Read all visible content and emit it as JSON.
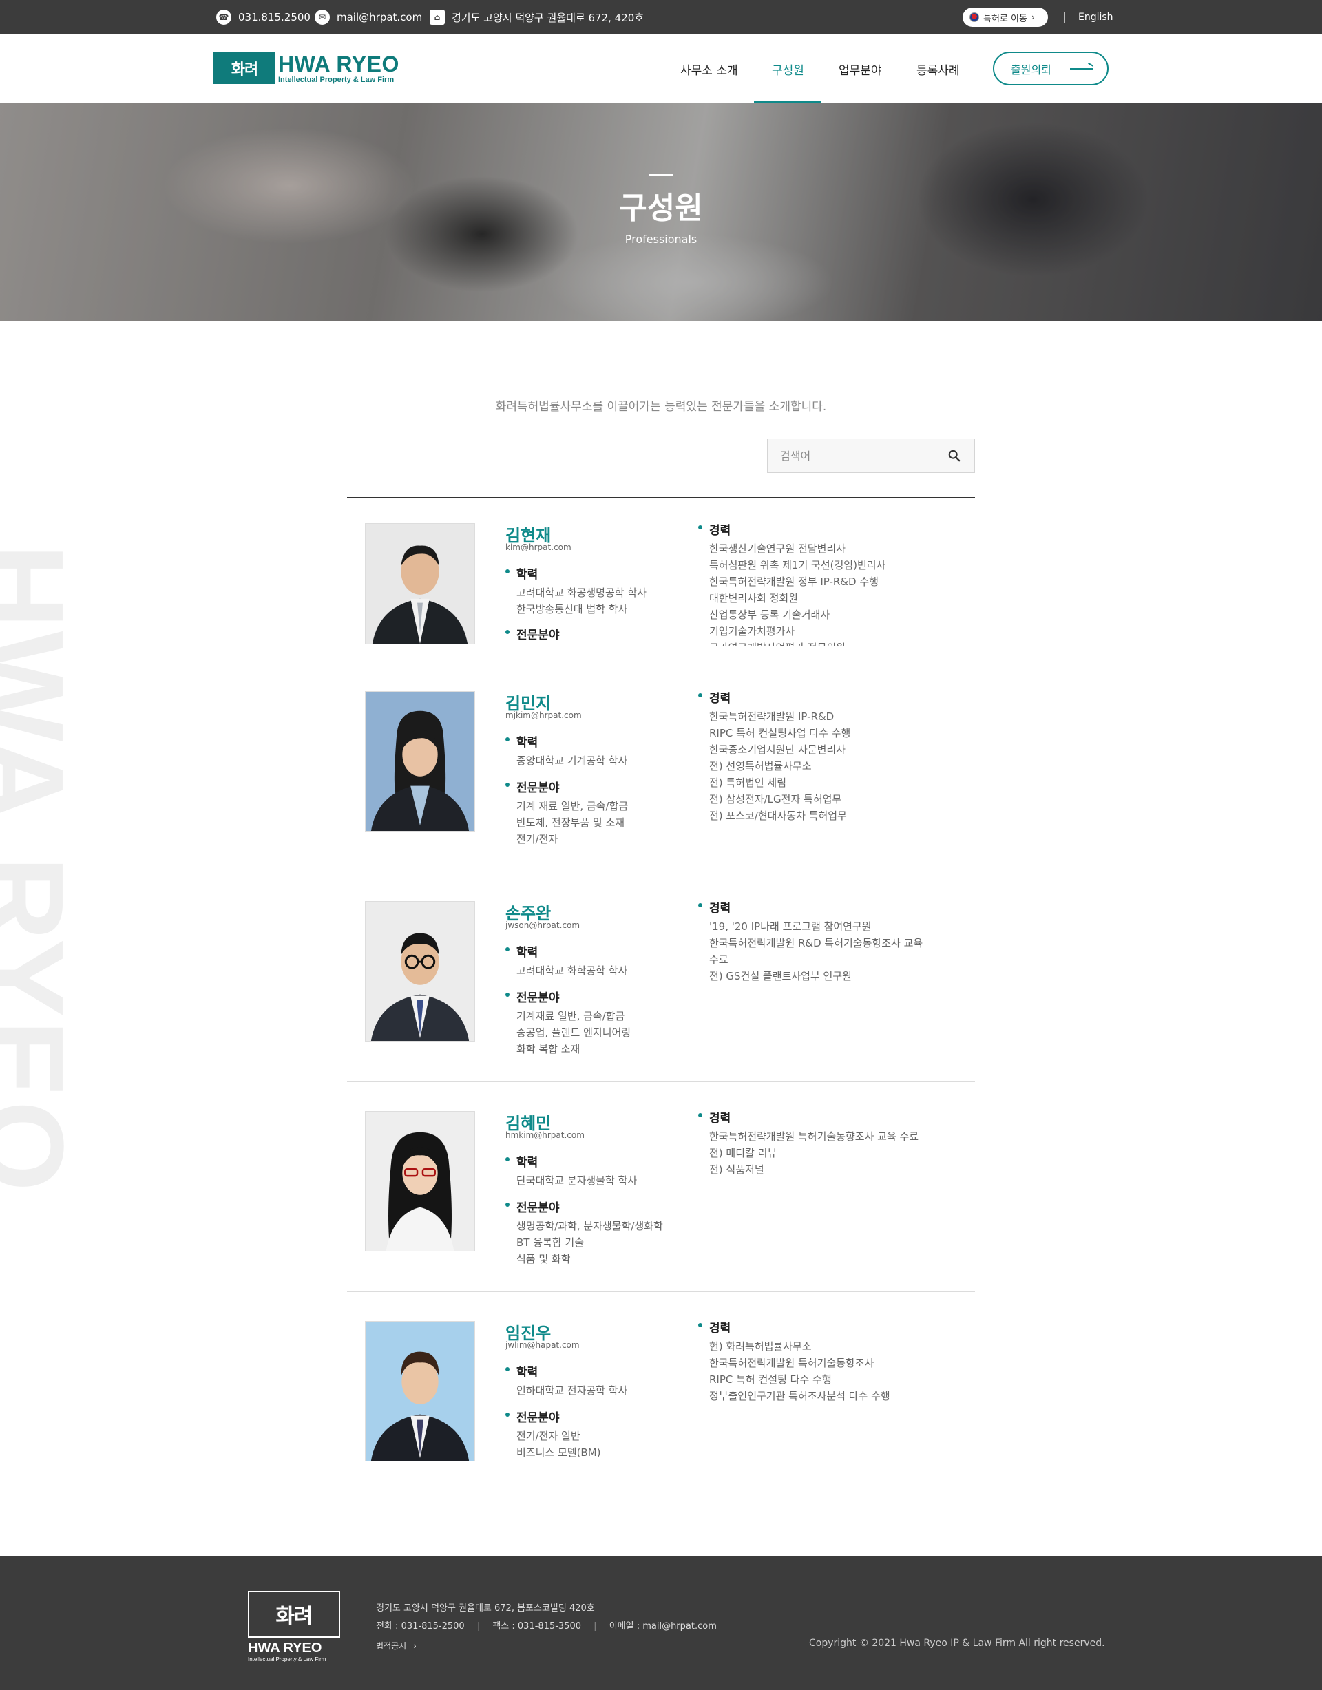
{
  "topbar": {
    "phone": "031.815.2500",
    "email": "mail@hrpat.com",
    "address": "경기도 고양시 덕양구 권율대로 672, 420호",
    "patent_button": "특허로 이동",
    "english": "English"
  },
  "header": {
    "logo_mark": "화려",
    "logo_main": "HWA RYEO",
    "logo_sub": "Intellectual Property & Law Firm",
    "nav": [
      "사무소 소개",
      "구성원",
      "업무분야",
      "등록사례"
    ],
    "active_nav": "구성원",
    "consult_button": "출원의뢰"
  },
  "hero": {
    "title": "구성원",
    "subtitle": "Professionals"
  },
  "watermark": "HWA RYEO",
  "intro": "화려특허법률사무소를 이끌어가는 능력있는 전문가들을 소개합니다.",
  "search": {
    "placeholder": "검색어"
  },
  "labels": {
    "education": "학력",
    "specialty": "전문분야",
    "career": "경력"
  },
  "members": [
    {
      "name": "김현재",
      "email": "kim@hrpat.com",
      "education": [
        "고려대학교 화공생명공학 학사",
        "한국방송통신대 법학 학사"
      ],
      "specialty": [],
      "career": [
        "한국생산기술연구원 전담변리사",
        "특허심판원 위촉 제1기 국선(경임)변리사",
        "한국특허전략개발원 정부 IP-R&D 수행",
        "대한변리사회 정회원",
        "산업통상부 등록 기술거래사",
        "기업기술가치평가사",
        "국가연구개발사업평가 전문위원"
      ]
    },
    {
      "name": "김민지",
      "email": "mjkim@hrpat.com",
      "education": [
        "중앙대학교 기계공학 학사"
      ],
      "specialty": [
        "기계 재료 일반, 금속/합금",
        "반도체, 전장부품 및 소재",
        "전기/전자"
      ],
      "career": [
        "한국특허전략개발원 IP-R&D",
        "RIPC 특허 컨설팅사업 다수 수행",
        "한국중소기업지원단 자문변리사",
        "전) 선영특허법률사무소",
        "전) 특허법인 세림",
        "전) 삼성전자/LG전자 특허업무",
        "전) 포스코/현대자동차 특허업무"
      ]
    },
    {
      "name": "손주완",
      "email": "jwson@hrpat.com",
      "education": [
        "고려대학교 화학공학 학사"
      ],
      "specialty": [
        "기계재료 일반, 금속/합금",
        "중공업, 플랜트 엔지니어링",
        "화학 복합 소재"
      ],
      "career": [
        "'19, '20 IP나래 프로그램 참여연구원",
        "한국특허전략개발원 R&D 특허기술동향조사 교육",
        "수료",
        "전) GS건설 플랜트사업부 연구원"
      ]
    },
    {
      "name": "김혜민",
      "email": "hmkim@hrpat.com",
      "education": [
        "단국대학교 분자생물학 학사"
      ],
      "specialty": [
        "생명공학/과학, 분자생물학/생화학",
        "BT 융복합 기술",
        "식품 및 화학"
      ],
      "career": [
        "한국특허전략개발원 특허기술동향조사 교육 수료",
        "전) 메디칼 리뷰",
        "전) 식품저널"
      ]
    },
    {
      "name": "임진우",
      "email": "jwlim@hapat.com",
      "education": [
        "인하대학교 전자공학 학사"
      ],
      "specialty": [
        "전기/전자 일반",
        "비즈니스 모델(BM)"
      ],
      "career": [
        "현) 화려특허법률사무소",
        "한국특허전략개발원 특허기술동향조사",
        "RIPC 특허 컨설팅 다수 수행",
        "정부출연연구기관 특허조사분석 다수 수행"
      ]
    }
  ],
  "footer": {
    "logo_mark": "화려",
    "logo_main": "HWA RYEO",
    "logo_sub": "Intellectual Property & Law Firm",
    "address": "경기도 고양시 덕양구 권율대로 672, 봄포스코빌딩 420호",
    "phone": "전화 : 031-815-2500",
    "fax": "팩스 : 031-815-3500",
    "email": "이메일 : mail@hrpat.com",
    "legal": "법적공지",
    "copyright": "Copyright © 2021 Hwa Ryeo IP & Law Firm All right reserved."
  },
  "colors": {
    "accent": "#0f8a8a",
    "dark_bar": "#3c3c3c"
  }
}
